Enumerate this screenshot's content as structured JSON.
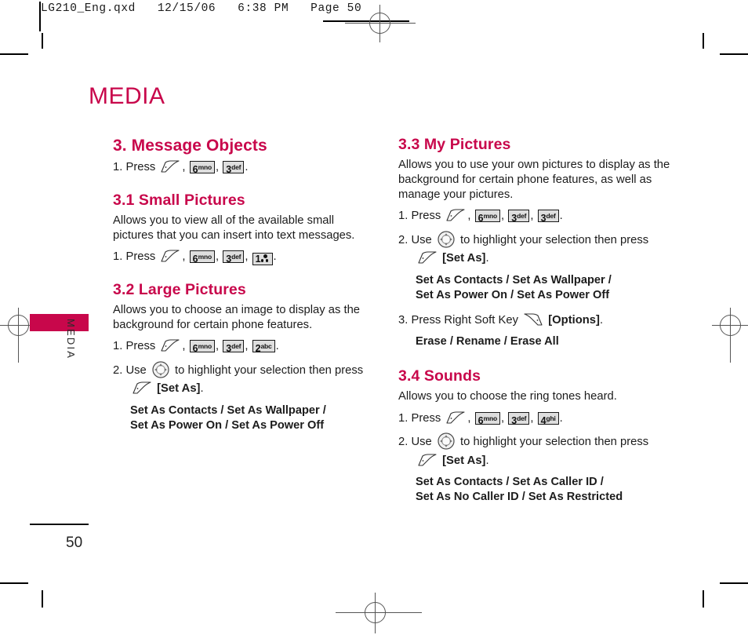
{
  "prepress": {
    "header_text": "LG210_Eng.qxd   12/15/06   6:38 PM   Page 50"
  },
  "page": {
    "chapter_title": "MEDIA",
    "side_tab_label": "MEDIA",
    "page_number": "50"
  },
  "left_column": {
    "sections": [
      {
        "heading": "3. Message Objects",
        "body": "",
        "steps": [
          {
            "prefix": "1. Press",
            "keys": [
              "soft-key-icon",
              "6mno",
              "3def"
            ],
            "suffix": "."
          }
        ],
        "options": []
      },
      {
        "heading": "3.1 Small Pictures",
        "body": "Allows you to view all of the available small pictures that you can insert into text messages.",
        "steps": [
          {
            "prefix": "1. Press",
            "keys": [
              "soft-key-icon",
              "6mno",
              "3def",
              "1voicemail"
            ],
            "suffix": "."
          }
        ],
        "options": []
      },
      {
        "heading": "3.2 Large Pictures",
        "body": "Allows you to choose an image to display as the background for certain phone features.",
        "steps": [
          {
            "prefix": "1. Press",
            "keys": [
              "soft-key-icon",
              "6mno",
              "3def",
              "2abc"
            ],
            "suffix": "."
          },
          {
            "prefix": "2. Use",
            "keys": [
              "nav-key-icon"
            ],
            "middle": "to highlight your selection then press",
            "second_line_keys": [
              "soft-key-icon"
            ],
            "second_line_label": "[Set As]",
            "suffix": "."
          }
        ],
        "options": [
          "Set As Contacts / Set As Wallpaper /",
          "Set As Power On / Set As Power Off"
        ]
      }
    ]
  },
  "right_column": {
    "sections": [
      {
        "heading": "3.3 My Pictures",
        "body": "Allows you to use your own pictures to display as the background for certain phone features, as well as manage your pictures.",
        "steps": [
          {
            "prefix": "1. Press",
            "keys": [
              "soft-key-icon",
              "6mno",
              "3def",
              "3def"
            ],
            "suffix": "."
          },
          {
            "prefix": "2. Use",
            "keys": [
              "nav-key-icon"
            ],
            "middle": "to highlight your selection then press",
            "second_line_keys": [
              "soft-key-icon"
            ],
            "second_line_label": "[Set As]",
            "suffix": "."
          },
          {
            "prefix": "3. Press Right Soft Key",
            "keys": [
              "right-soft-key-icon"
            ],
            "label": "[Options]",
            "suffix": "."
          }
        ],
        "options": [
          "Set As Contacts / Set As Wallpaper /",
          "Set As Power On / Set As Power Off"
        ],
        "options2": [
          "Erase / Rename / Erase All"
        ]
      },
      {
        "heading": "3.4 Sounds",
        "body": "Allows you to choose the ring tones heard.",
        "steps": [
          {
            "prefix": "1. Press",
            "keys": [
              "soft-key-icon",
              "6mno",
              "3def",
              "4ghi"
            ],
            "suffix": "."
          },
          {
            "prefix": "2. Use",
            "keys": [
              "nav-key-icon"
            ],
            "middle": "to highlight your selection then press",
            "second_line_keys": [
              "soft-key-icon"
            ],
            "second_line_label": "[Set As]",
            "suffix": "."
          }
        ],
        "options": [
          "Set As Contacts / Set As Caller ID /",
          "Set As No Caller ID / Set As Restricted"
        ]
      }
    ]
  },
  "labels": {
    "press": "1. Press",
    "use": "2. Use",
    "use_mid": "to highlight your selection then press",
    "set_as": "[Set As]",
    "options": "[Options]",
    "right_soft": "3. Press Right Soft Key",
    "period": ".",
    "comma": ","
  },
  "keys": {
    "k6": {
      "digit": "6",
      "letters": "mno"
    },
    "k3": {
      "digit": "3",
      "letters": "def"
    },
    "k2": {
      "digit": "2",
      "letters": "abc"
    },
    "k4": {
      "digit": "4",
      "letters": "ghi"
    },
    "k1": {
      "digit": "1",
      "letters": ""
    }
  },
  "colors": {
    "accent": "#c8074b",
    "text": "#1c1c1c",
    "key_fill": "#dedede"
  }
}
